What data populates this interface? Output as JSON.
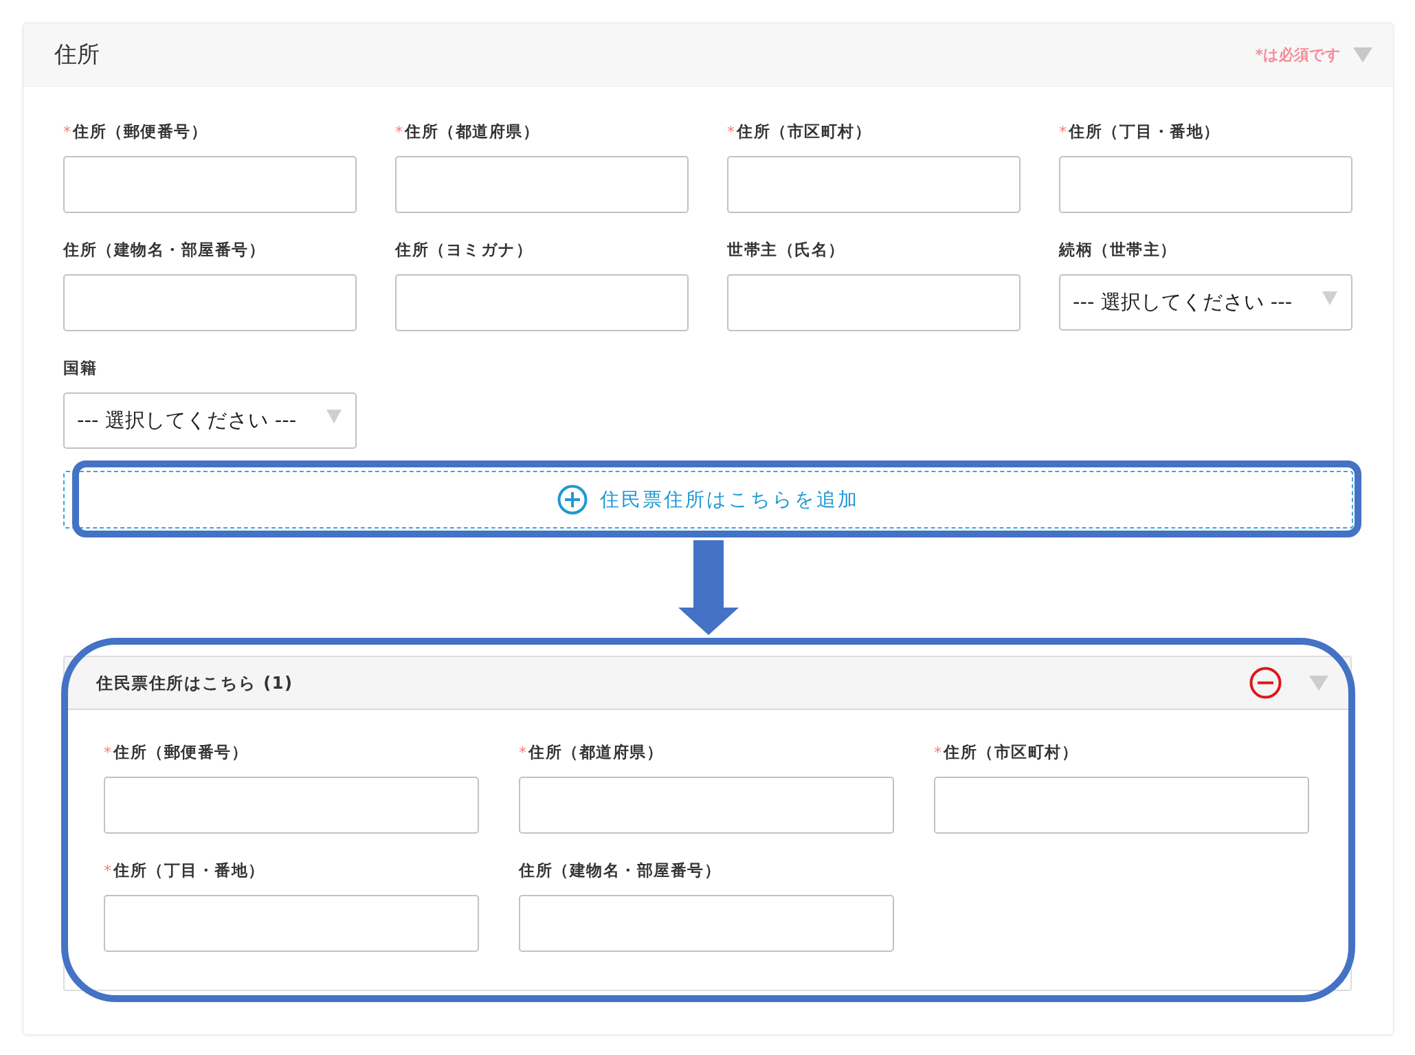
{
  "section": {
    "title": "住所",
    "required_note": "*は必須です"
  },
  "fields": [
    {
      "kind": "text",
      "mark": "*",
      "label": "住所（郵便番号）"
    },
    {
      "kind": "text",
      "mark": "*",
      "label": "住所（都道府県）"
    },
    {
      "kind": "text",
      "mark": "*",
      "label": "住所（市区町村）"
    },
    {
      "kind": "text",
      "mark": "*",
      "label": "住所（丁目・番地）"
    },
    {
      "kind": "text",
      "label": "住所（建物名・部屋番号）"
    },
    {
      "kind": "text",
      "label": "住所（ヨミガナ）"
    },
    {
      "kind": "text",
      "label": "世帯主（氏名）"
    },
    {
      "kind": "select",
      "label": "続柄（世帯主）",
      "value": "--- 選択してください ---"
    },
    {
      "kind": "select",
      "label": "国籍",
      "value": "--- 選択してください ---"
    }
  ],
  "add_button": {
    "label": "住民票住所はこちらを追加"
  },
  "subsection": {
    "title": "住民票住所はこちら (1)",
    "fields": [
      {
        "kind": "text",
        "mark": "*",
        "label": "住所（郵便番号）"
      },
      {
        "kind": "text",
        "mark": "*",
        "label": "住所（都道府県）"
      },
      {
        "kind": "text",
        "mark": "*",
        "label": "住所（市区町村）"
      },
      {
        "kind": "text",
        "mark": "*",
        "label": "住所（丁目・番地）"
      },
      {
        "kind": "text",
        "label": "住所（建物名・部屋番号）"
      }
    ]
  }
}
